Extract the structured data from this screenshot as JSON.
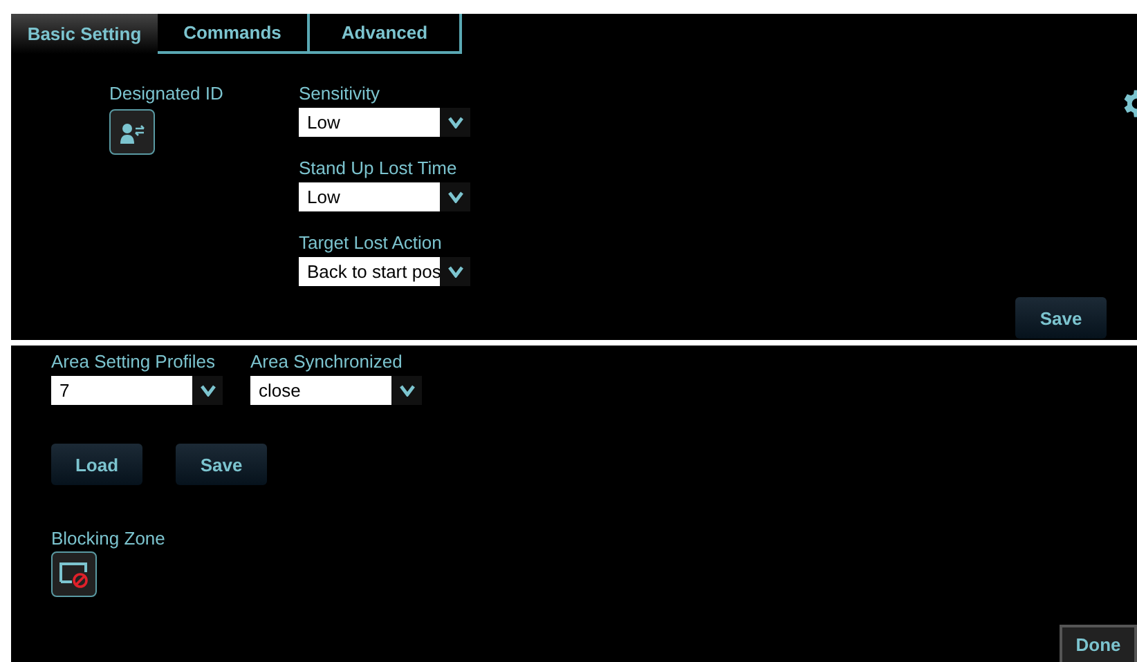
{
  "tabs": [
    {
      "label": "Basic Setting",
      "selected": true
    },
    {
      "label": "Commands",
      "selected": false
    },
    {
      "label": "Advanced",
      "selected": false
    }
  ],
  "designated_id": {
    "label": "Designated ID"
  },
  "settings": [
    {
      "label": "Sensitivity",
      "value": "Low"
    },
    {
      "label": "Stand Up Lost Time",
      "value": "Low"
    },
    {
      "label": "Target Lost Action",
      "value": "Back to start pos"
    }
  ],
  "top_save": "Save",
  "area_fields": [
    {
      "label": "Area Setting Profiles",
      "value": "7"
    },
    {
      "label": "Area Synchronized",
      "value": "close"
    }
  ],
  "area_buttons": [
    "Load",
    "Save"
  ],
  "blocking_zone": {
    "label": "Blocking Zone"
  },
  "done": "Done"
}
